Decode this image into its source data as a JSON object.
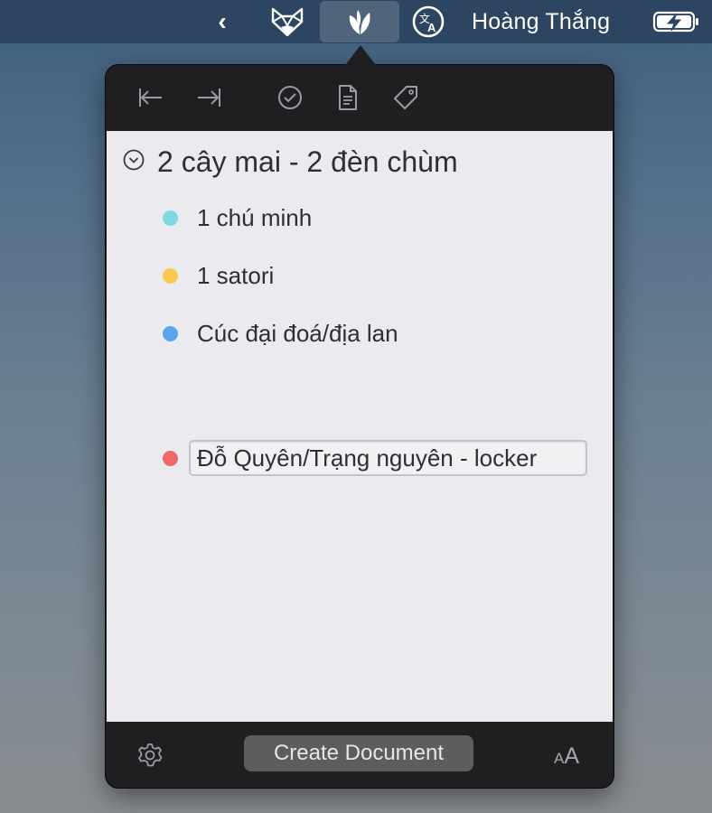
{
  "menubar": {
    "user_name": "Hoàng Thắng",
    "icons": [
      "chevron-left-icon",
      "fox-icon",
      "leaf-icon",
      "translate-icon",
      "battery-charging-icon"
    ]
  },
  "toolbar": {
    "buttons": [
      "outdent-icon",
      "indent-icon",
      "check-circle-icon",
      "document-icon",
      "tag-icon"
    ]
  },
  "content": {
    "heading": "2 cây mai - 2 đèn chùm",
    "items": [
      {
        "label": "1 chú minh",
        "color": "#7fd9e0"
      },
      {
        "label": "1 satori",
        "color": "#f7c951"
      },
      {
        "label": "Cúc đại đoá/địa lan",
        "color": "#5aa5f0"
      },
      {
        "label": "Đỗ Quyên/Trạng nguyên - locker",
        "color": "#ee6a66"
      }
    ]
  },
  "footer": {
    "create_label": "Create Document",
    "font_small": "A",
    "font_big": "A"
  },
  "colors": {
    "menubar": "#2c4661",
    "popover": "#1f1f22",
    "content_bg": "#ebebef"
  }
}
